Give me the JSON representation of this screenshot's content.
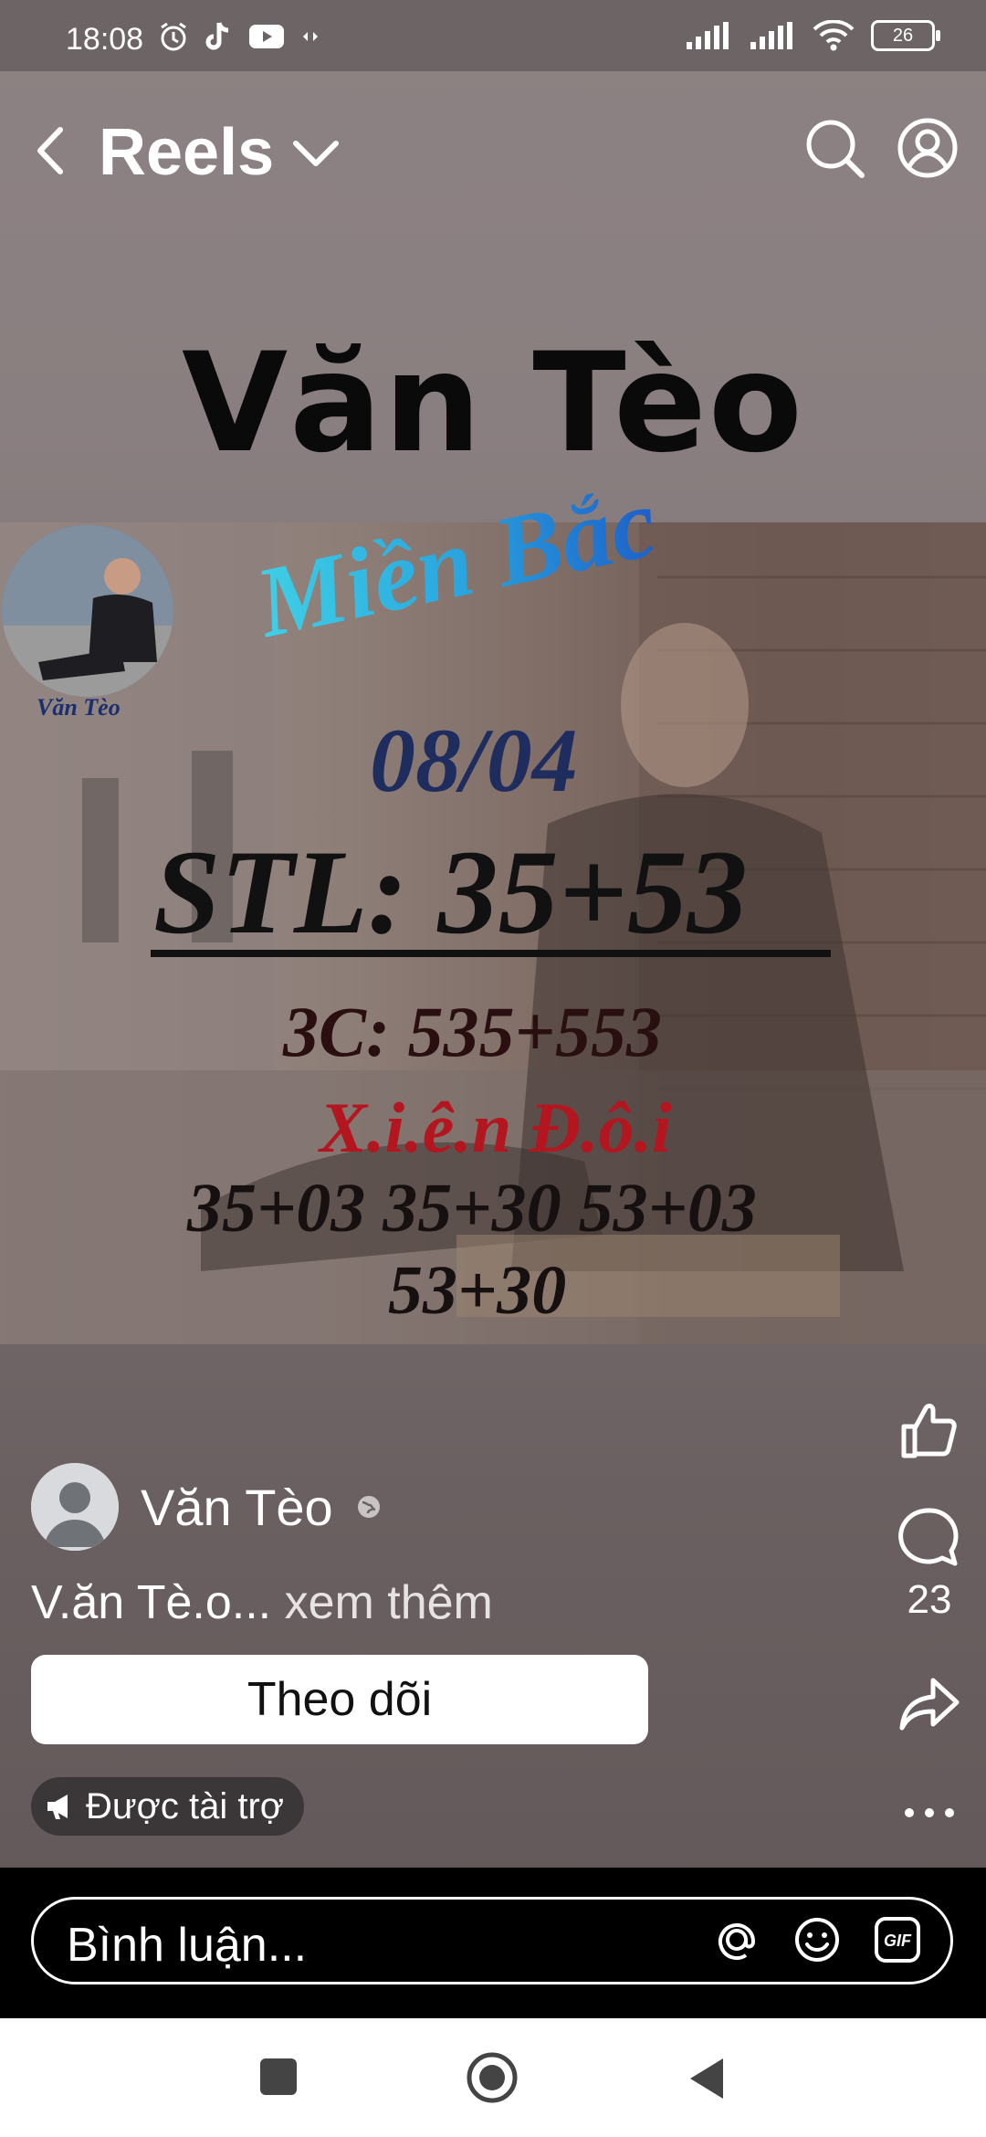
{
  "status": {
    "time": "18:08",
    "battery": "26"
  },
  "header": {
    "title": "Reels"
  },
  "post": {
    "overlay_title": "Văn Tèo",
    "image": {
      "avatar_label": "Văn Tèo",
      "region": "Miền Bắc",
      "date": "08/04",
      "stl": "STL: 35+53",
      "three_c": "3C: 535+553",
      "xien": "X.i.ê.n Đ.ô.i",
      "pairs_line1": "35+03 35+30 53+03",
      "pairs_line2": "53+30"
    },
    "author": {
      "name": "Văn Tèo"
    },
    "caption": {
      "text": "V.ăn Tè.o...",
      "more": "xem thêm"
    },
    "follow_label": "Theo dõi",
    "sponsored_label": "Được tài trợ",
    "comments_count": "23"
  },
  "comment_box": {
    "placeholder": "Bình luận..."
  },
  "icons": {
    "back": "chevron-left-icon",
    "dropdown": "chevron-down-icon",
    "search": "search-icon",
    "profile": "profile-icon",
    "like": "thumbs-up-icon",
    "comment": "comment-icon",
    "share": "share-icon",
    "more": "more-icon",
    "globe": "globe-icon",
    "megaphone": "megaphone-icon",
    "mention": "at-icon",
    "emoji": "emoji-icon",
    "gif": "gif-icon"
  }
}
